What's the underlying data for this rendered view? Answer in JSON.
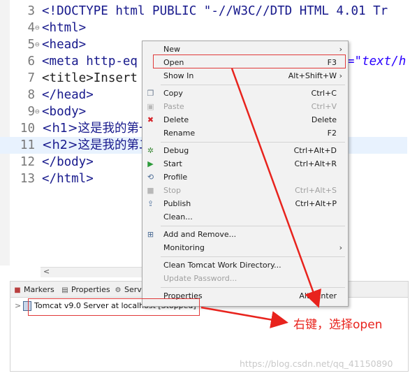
{
  "editor": {
    "lines": [
      {
        "num": "3",
        "fold": "",
        "text": "<!DOCTYPE html PUBLIC \"-//W3C//DTD HTML 4.01 Tr"
      },
      {
        "num": "4",
        "fold": "⊖",
        "text": "<html>"
      },
      {
        "num": "5",
        "fold": "⊖",
        "text": "<head>"
      },
      {
        "num": "6",
        "fold": "",
        "text": "<meta http-eq"
      },
      {
        "num": "7",
        "fold": "",
        "text": "<title>Insert"
      },
      {
        "num": "8",
        "fold": "",
        "text": "</head>"
      },
      {
        "num": "9",
        "fold": "⊖",
        "text": "<body>"
      },
      {
        "num": "10",
        "fold": "",
        "text": "<h1>这是我的第一"
      },
      {
        "num": "11",
        "fold": "",
        "text": "<h2>这是我的第二"
      },
      {
        "num": "12",
        "fold": "",
        "text": "</body>"
      },
      {
        "num": "13",
        "fold": "",
        "text": "</html>"
      }
    ],
    "meta_tail": "=\"text/h"
  },
  "hscroll": {
    "left_arrow": "<"
  },
  "panel": {
    "tabs": [
      {
        "icon": "markers-icon",
        "label": "Markers"
      },
      {
        "icon": "properties-icon",
        "label": "Properties"
      },
      {
        "icon": "servers-icon",
        "label": "Serve"
      }
    ],
    "tree": {
      "chevron": ">",
      "server_label": "Tomcat v9.0 Server at localhost  [Stopped]"
    }
  },
  "context_menu": {
    "items": [
      {
        "label": "New",
        "shortcut": "",
        "submenu": true,
        "icon": "",
        "disabled": false
      },
      {
        "label": "Open",
        "shortcut": "F3",
        "submenu": false,
        "icon": "",
        "disabled": false
      },
      {
        "label": "Show In",
        "shortcut": "Alt+Shift+W",
        "submenu": true,
        "icon": "",
        "disabled": false
      },
      {
        "label": "Copy",
        "shortcut": "Ctrl+C",
        "submenu": false,
        "icon": "copy-icon",
        "disabled": false
      },
      {
        "label": "Paste",
        "shortcut": "Ctrl+V",
        "submenu": false,
        "icon": "paste-icon",
        "disabled": true
      },
      {
        "label": "Delete",
        "shortcut": "Delete",
        "submenu": false,
        "icon": "delete-icon",
        "disabled": false
      },
      {
        "label": "Rename",
        "shortcut": "F2",
        "submenu": false,
        "icon": "",
        "disabled": false
      },
      {
        "label": "Debug",
        "shortcut": "Ctrl+Alt+D",
        "submenu": false,
        "icon": "debug-icon",
        "disabled": false
      },
      {
        "label": "Start",
        "shortcut": "Ctrl+Alt+R",
        "submenu": false,
        "icon": "start-icon",
        "disabled": false
      },
      {
        "label": "Profile",
        "shortcut": "",
        "submenu": false,
        "icon": "profile-icon",
        "disabled": false
      },
      {
        "label": "Stop",
        "shortcut": "Ctrl+Alt+S",
        "submenu": false,
        "icon": "stop-icon",
        "disabled": true
      },
      {
        "label": "Publish",
        "shortcut": "Ctrl+Alt+P",
        "submenu": false,
        "icon": "publish-icon",
        "disabled": false
      },
      {
        "label": "Clean...",
        "shortcut": "",
        "submenu": false,
        "icon": "",
        "disabled": false
      },
      {
        "label": "Add and Remove...",
        "shortcut": "",
        "submenu": false,
        "icon": "add-remove-icon",
        "disabled": false
      },
      {
        "label": "Monitoring",
        "shortcut": "",
        "submenu": true,
        "icon": "",
        "disabled": false
      },
      {
        "label": "Clean Tomcat Work Directory...",
        "shortcut": "",
        "submenu": false,
        "icon": "",
        "disabled": false
      },
      {
        "label": "Update Password...",
        "shortcut": "",
        "submenu": false,
        "icon": "",
        "disabled": true
      },
      {
        "label": "Properties",
        "shortcut": "Alt+Enter",
        "submenu": false,
        "icon": "",
        "disabled": false
      }
    ]
  },
  "annotation": {
    "text": "右键，选择open",
    "color": "#e8231d"
  },
  "watermark": "https://blog.csdn.net/qq_41150890",
  "colors": {
    "tag": "#17198c",
    "current_line": "#e8f2fe",
    "menu_bg": "#f2f2f2",
    "annotation_red": "#e03a3a"
  }
}
